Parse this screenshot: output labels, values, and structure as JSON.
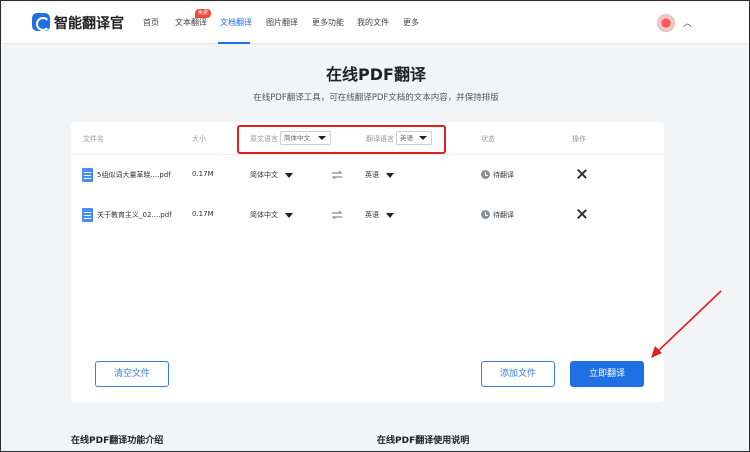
{
  "header": {
    "logo_text": "智能翻译官",
    "nav": [
      {
        "label": "首页"
      },
      {
        "label": "文本翻译"
      },
      {
        "label": "文档翻译"
      },
      {
        "label": "图片翻译"
      },
      {
        "label": "更多功能"
      },
      {
        "label": "我的文件"
      },
      {
        "label": "更多"
      }
    ],
    "free_badge": "免费",
    "active_nav": "文档翻译"
  },
  "page": {
    "title": "在线PDF翻译",
    "subtitle": "在线PDF翻译工具，可在线翻译PDF文档的文本内容，并保持排版"
  },
  "table": {
    "col_file": "文件名",
    "col_size": "大小",
    "col_source_lang": "原文语言",
    "source_lang_value": "简体中文",
    "col_target_lang": "翻译语言",
    "target_lang_value": "英语",
    "col_status": "状态",
    "col_action": "操作",
    "rows": [
      {
        "name": "5组似词大量革晓....pdf",
        "size": "0.17M",
        "source": "简体中文",
        "target": "英语",
        "status": "待翻译"
      },
      {
        "name": "关于教育主义_02....pdf",
        "size": "0.17M",
        "source": "简体中文",
        "target": "英语",
        "status": "待翻译"
      }
    ]
  },
  "buttons": {
    "clear": "清空文件",
    "add": "添加文件",
    "translate": "立即翻译"
  },
  "sections": {
    "intro": "在线PDF翻译功能介绍",
    "usage": "在线PDF翻译使用说明"
  },
  "colors": {
    "accent": "#1f6fe5",
    "highlight": "#e02020",
    "badge": "#f04a3e"
  }
}
